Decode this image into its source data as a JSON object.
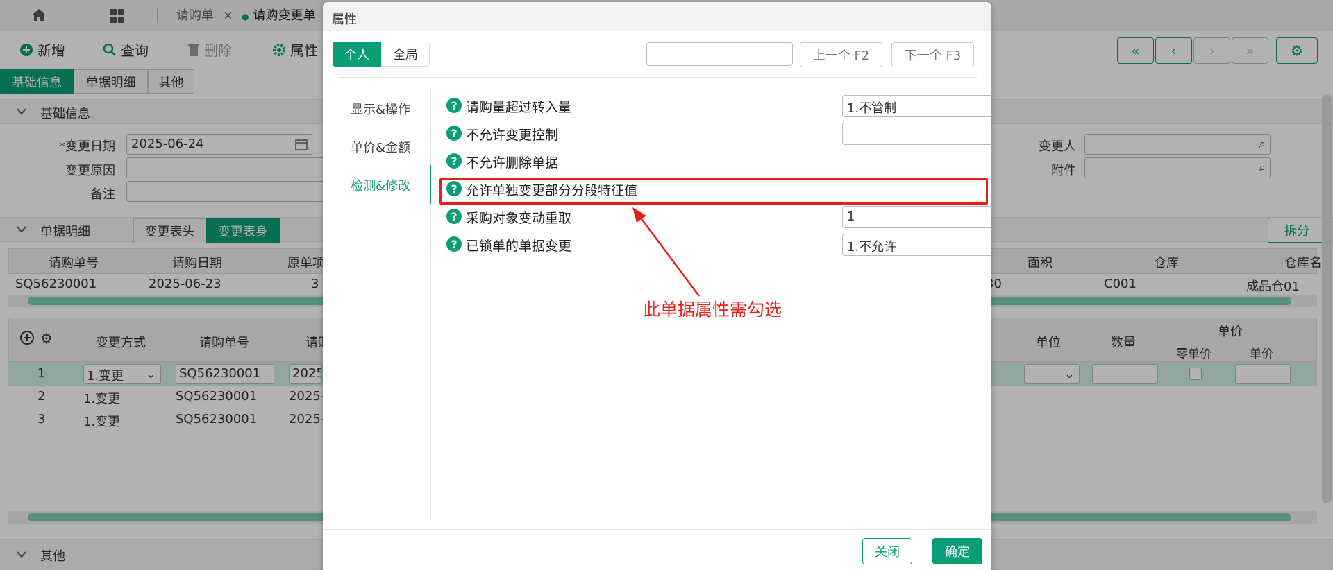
{
  "app": {
    "top_tabs": [
      "请购单",
      "请购变更单"
    ],
    "toolbar": {
      "new": "新增",
      "query": "查询",
      "delete": "删除",
      "props": "属性"
    },
    "sub_tabs": [
      "基础信息",
      "单据明细",
      "其他"
    ],
    "sections": {
      "basic": "基础信息",
      "detail": "单据明细",
      "other": "其他"
    },
    "form": {
      "change_date_label": "变更日期",
      "change_date_value": "2025-06-24",
      "change_reason_label": "变更原因",
      "remark_label": "备注",
      "changer_label": "变更人",
      "attach_label": "附件"
    },
    "detail_tabs": {
      "head": "变更表头",
      "body": "变更表身",
      "split": "拆分"
    },
    "upper_grid": {
      "columns": [
        "请购单号",
        "请购日期",
        "原单项",
        "面积",
        "仓库",
        "仓库名"
      ],
      "row": [
        "SQ56230001",
        "2025-06-23",
        "3",
        "30",
        "C001",
        "成品仓01"
      ]
    },
    "lower_grid": {
      "columns": [
        "变更方式",
        "请购单号",
        "请购",
        "单位",
        "数量",
        "单价",
        "零单价",
        "单价"
      ],
      "rows": [
        {
          "no": "1",
          "mode": "1.变更",
          "bill": "SQ56230001",
          "date": "2025-"
        },
        {
          "no": "2",
          "mode": "1.变更",
          "bill": "SQ56230001",
          "date": "2025-"
        },
        {
          "no": "3",
          "mode": "1.变更",
          "bill": "SQ56230001",
          "date": "2025-"
        }
      ]
    }
  },
  "dialog": {
    "title": "属性",
    "scope": {
      "personal": "个人",
      "global": "全局"
    },
    "search_placeholder": "",
    "prev_btn": "上一个 F2",
    "next_btn": "下一个 F3",
    "sidebar": [
      {
        "label": "显示&操作",
        "active": false
      },
      {
        "label": "单价&金额",
        "active": false
      },
      {
        "label": "检测&修改",
        "active": true
      }
    ],
    "props": [
      {
        "label": "请购量超过转入量",
        "control": "select",
        "value": "1.不管制"
      },
      {
        "label": "不允许变更控制",
        "control": "lookup",
        "value": ""
      },
      {
        "label": "不允许删除单据",
        "control": "checkbox",
        "checked": false
      },
      {
        "label": "允许单独变更部分分段特征值",
        "control": "checkbox",
        "checked": true
      },
      {
        "label": "采购对象变动重取",
        "control": "lookup",
        "value": "1"
      },
      {
        "label": "已锁单的单据变更",
        "control": "select",
        "value": "1.不允许"
      }
    ],
    "annotation": "此单据属性需勾选",
    "close_btn": "关闭",
    "ok_btn": "确定"
  },
  "colors": {
    "accent": "#0a9e76",
    "annotation": "#e8201a"
  }
}
